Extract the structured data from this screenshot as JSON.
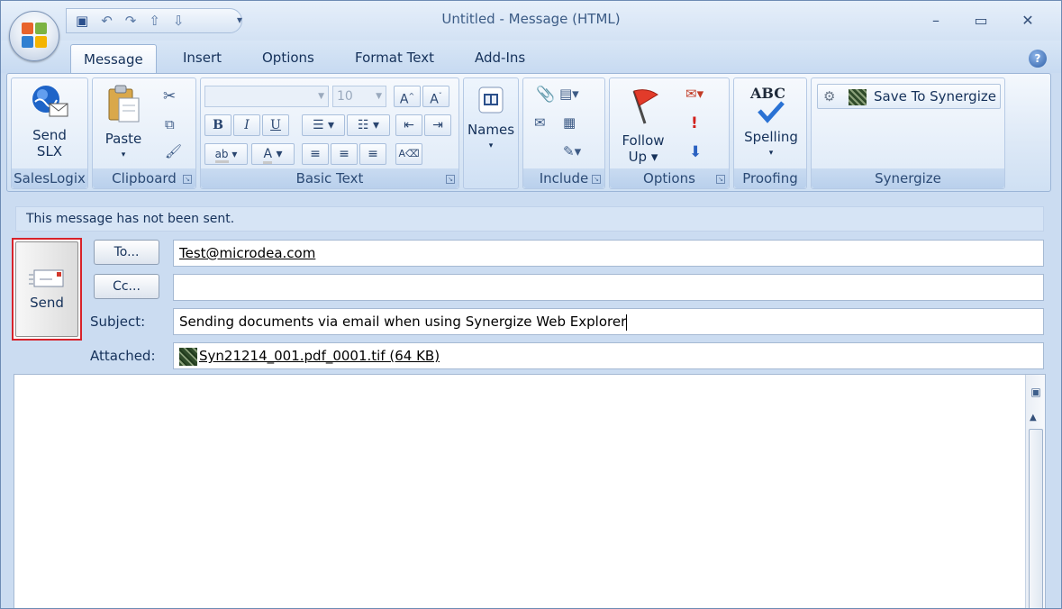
{
  "window": {
    "title": "Untitled - Message (HTML)",
    "minimize": "–",
    "maximize": "▭",
    "close": "✕"
  },
  "quick_access": {
    "save_icon": "save-icon",
    "undo_icon": "undo-icon",
    "redo_icon": "redo-icon",
    "up_icon": "arrow-up-icon",
    "down_icon": "arrow-down-icon",
    "dropdown": "▾"
  },
  "tabs": [
    "Message",
    "Insert",
    "Options",
    "Format Text",
    "Add-Ins"
  ],
  "help_label": "?",
  "ribbon": {
    "saleslogix": {
      "send_slx_line1": "Send",
      "send_slx_line2": "SLX",
      "label": "SalesLogix"
    },
    "clipboard": {
      "paste": "Paste",
      "label": "Clipboard"
    },
    "basic_text": {
      "font_size": "10",
      "bold": "B",
      "italic": "I",
      "underline": "U",
      "label": "Basic Text"
    },
    "names": {
      "label": "Names"
    },
    "include": {
      "label": "Include"
    },
    "options": {
      "follow_up_line1": "Follow",
      "follow_up_line2": "Up",
      "label": "Options"
    },
    "proofing": {
      "spelling": "Spelling",
      "abc": "ABC",
      "label": "Proofing"
    },
    "synergize": {
      "save_to": "Save To Synergize",
      "label": "Synergize"
    }
  },
  "infobar": "This message has not been sent.",
  "compose": {
    "send_label": "Send",
    "to_button": "To...",
    "cc_button": "Cc...",
    "subject_label": "Subject:",
    "attached_label": "Attached:",
    "to_value": "Test@microdea.com",
    "cc_value": "",
    "subject_value": "Sending documents via email when using Synergize Web Explorer",
    "attachment": "Syn21214_001.pdf_0001.tif (64 KB)"
  },
  "colors": {
    "frame": "#6d8bb4",
    "ribbon": "#dce8f6",
    "highlight_border": "#d7222a"
  }
}
